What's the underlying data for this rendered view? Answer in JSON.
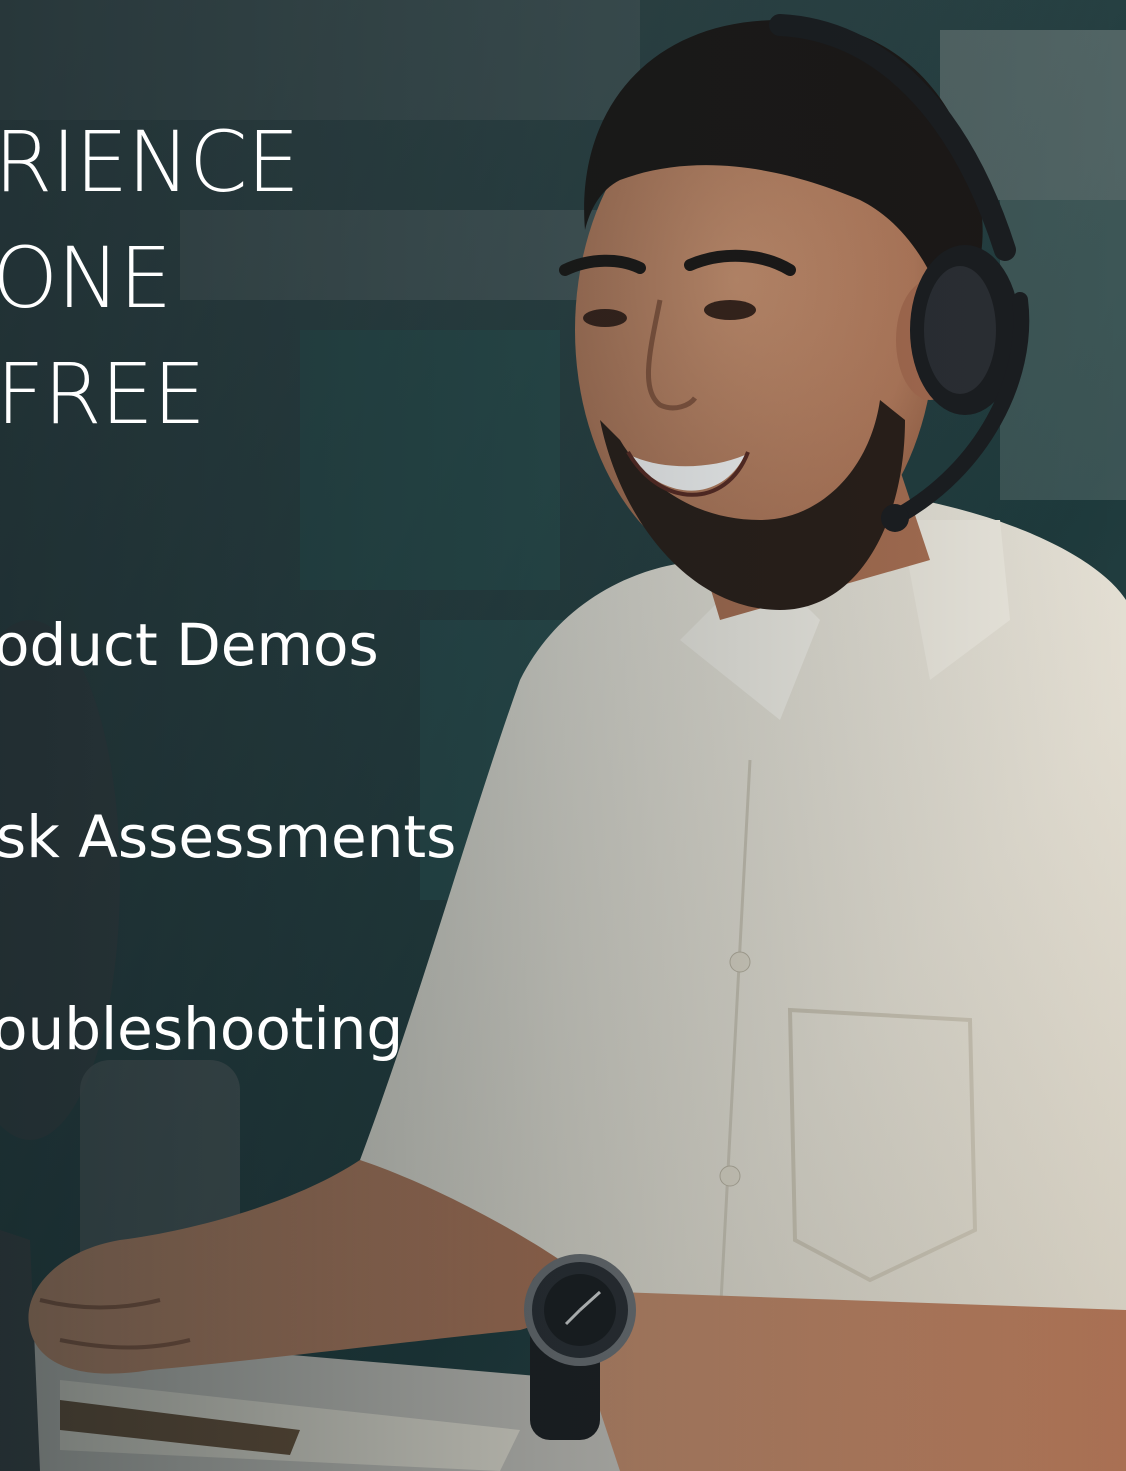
{
  "headline": {
    "line1": "RIENCE",
    "line2": "ONE",
    "line3": "FREE"
  },
  "bullets": [
    {
      "label": "oduct Demos"
    },
    {
      "label": "sk Assessments"
    },
    {
      "label": "oubleshooting"
    }
  ],
  "colors": {
    "text": "#ffffff",
    "background_dark": "#1f3a3e",
    "shirt": "#e9e6dc",
    "skin": "#b98062",
    "hair": "#1c1816",
    "headset": "#1b1d20"
  },
  "image": {
    "subject": "smiling man with headset typing at desk"
  }
}
